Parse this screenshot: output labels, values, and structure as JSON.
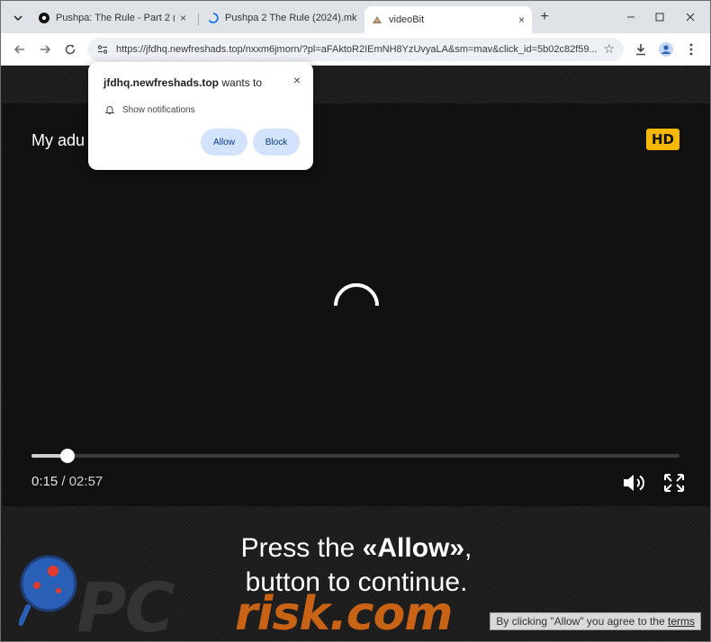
{
  "browser": {
    "tabs": [
      {
        "title": "Pushpa: The Rule - Part 2 (2024",
        "active": false
      },
      {
        "title": "Pushpa 2 The Rule (2024).mkv",
        "active": false
      },
      {
        "title": "videoBit",
        "active": true
      }
    ],
    "close_glyph": "×",
    "new_tab_glyph": "+",
    "url": "https://jfdhq.newfreshads.top/nxxm6jmorn/?pl=aFAktoR2IEmNH8YzUvyaLA&sm=mav&click_id=5b02c82f59..."
  },
  "permission_prompt": {
    "domain": "jfdhq.newfreshads.top",
    "wants_to": " wants to",
    "item": "Show notifications",
    "allow_label": "Allow",
    "block_label": "Block",
    "close_glyph": "×"
  },
  "player": {
    "title": "My adu",
    "hd_badge": "HD",
    "current_time": "0:15",
    "separator": " / ",
    "duration": "02:57",
    "progress_fraction": 0.055
  },
  "overlay": {
    "cta_prefix": "Press the ",
    "cta_bold": "«Allow»",
    "cta_suffix": ",",
    "cta_line2": "button to continue.",
    "consent_text": "By clicking \"Allow\" you agree to the ",
    "consent_link": "terms"
  },
  "watermark": {
    "logo_text": "PC",
    "risk_text": "risk.com"
  },
  "colors": {
    "hd_badge": "#f5b800",
    "allow_button": "#d3e3fd",
    "watermark_orange": "#e66e14"
  }
}
